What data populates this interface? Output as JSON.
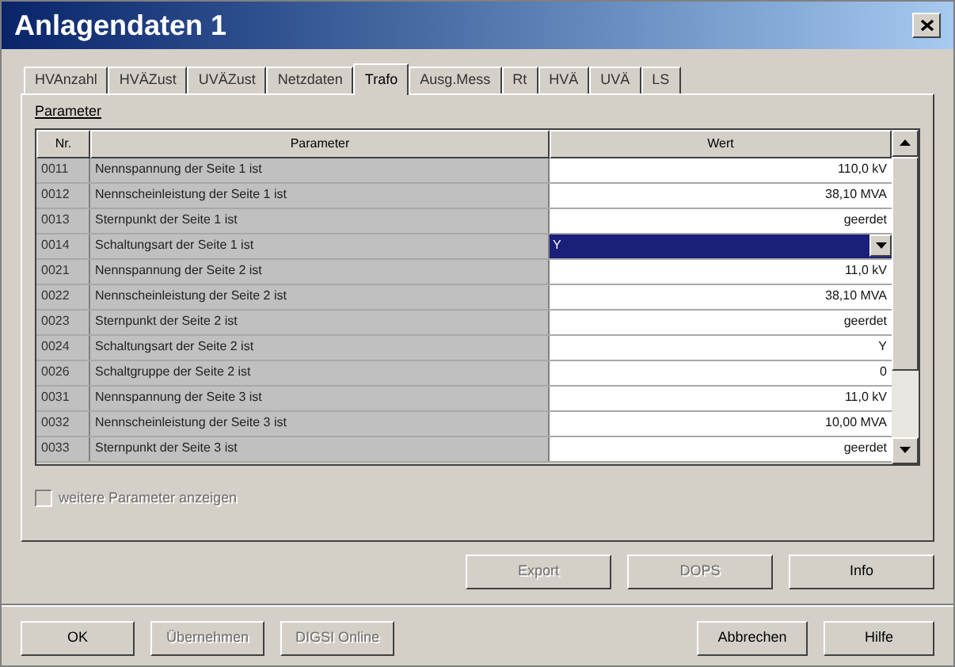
{
  "window": {
    "title": "Anlagendaten 1"
  },
  "tabs": [
    {
      "label": "HVAnzahl",
      "selected": false
    },
    {
      "label": "HVÄZust",
      "selected": false
    },
    {
      "label": "UVÄZust",
      "selected": false
    },
    {
      "label": "Netzdaten",
      "selected": false
    },
    {
      "label": "Trafo",
      "selected": true
    },
    {
      "label": "Ausg.Mess",
      "selected": false
    },
    {
      "label": "Rt",
      "selected": false
    },
    {
      "label": "HVÄ",
      "selected": false
    },
    {
      "label": "UVÄ",
      "selected": false
    },
    {
      "label": "LS",
      "selected": false
    }
  ],
  "group": {
    "title": "Parameter"
  },
  "table": {
    "columns": [
      "Nr.",
      "Parameter",
      "Wert"
    ],
    "rows": [
      {
        "nr": "0011",
        "parameter": "Nennspannung der Seite 1 ist",
        "wert": "110,0 kV",
        "selected": false
      },
      {
        "nr": "0012",
        "parameter": "Nennscheinleistung der Seite 1 ist",
        "wert": "38,10 MVA",
        "selected": false
      },
      {
        "nr": "0013",
        "parameter": "Sternpunkt der Seite 1 ist",
        "wert": "geerdet",
        "selected": false
      },
      {
        "nr": "0014",
        "parameter": "Schaltungsart der Seite 1 ist",
        "wert": "Y",
        "selected": true
      },
      {
        "nr": "0021",
        "parameter": "Nennspannung der Seite 2 ist",
        "wert": "11,0 kV",
        "selected": false
      },
      {
        "nr": "0022",
        "parameter": "Nennscheinleistung der Seite 2 ist",
        "wert": "38,10 MVA",
        "selected": false
      },
      {
        "nr": "0023",
        "parameter": "Sternpunkt der Seite 2 ist",
        "wert": "geerdet",
        "selected": false
      },
      {
        "nr": "0024",
        "parameter": "Schaltungsart der Seite 2 ist",
        "wert": "Y",
        "selected": false
      },
      {
        "nr": "0026",
        "parameter": "Schaltgruppe der Seite 2 ist",
        "wert": "0",
        "selected": false
      },
      {
        "nr": "0031",
        "parameter": "Nennspannung der Seite 3 ist",
        "wert": "11,0 kV",
        "selected": false
      },
      {
        "nr": "0032",
        "parameter": "Nennscheinleistung der Seite 3 ist",
        "wert": "10,00 MVA",
        "selected": false
      },
      {
        "nr": "0033",
        "parameter": "Sternpunkt der Seite 3 ist",
        "wert": "geerdet",
        "selected": false
      }
    ]
  },
  "checkbox": {
    "label": "weitere Parameter anzeigen",
    "checked": false,
    "disabled": true
  },
  "panel_buttons": [
    {
      "label": "Export",
      "disabled": true
    },
    {
      "label": "DOPS",
      "disabled": true
    },
    {
      "label": "Info",
      "disabled": false
    }
  ],
  "left_buttons": [
    {
      "label": "OK",
      "disabled": false
    },
    {
      "label": "Übernehmen",
      "disabled": true
    },
    {
      "label": "DIGSI Online",
      "disabled": true
    }
  ],
  "right_buttons": [
    {
      "label": "Abbrechen",
      "disabled": false
    },
    {
      "label": "Hilfe",
      "disabled": false
    }
  ]
}
